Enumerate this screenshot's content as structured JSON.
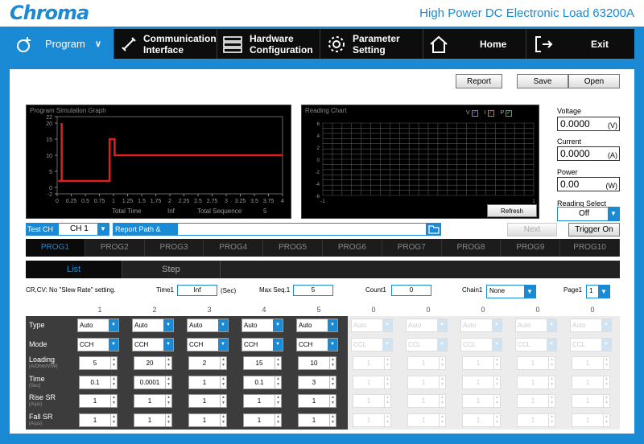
{
  "app": {
    "logo": "Chroma",
    "title": "High Power DC Electronic Load 63200A"
  },
  "nav": {
    "program": "Program",
    "comm1": "Communication",
    "comm2": "Interface",
    "hw1": "Hardware",
    "hw2": "Configuration",
    "ps1": "Parameter",
    "ps2": "Setting",
    "home": "Home",
    "exit": "Exit"
  },
  "toolbar": {
    "report": "Report",
    "save": "Save",
    "open": "Open"
  },
  "sim": {
    "title": "Program Simulation Graph",
    "total_time_label": "Total Time",
    "total_time_val": "Inf",
    "total_seq_label": "Total Sequence",
    "total_seq_val": "5",
    "yticks": [
      "22",
      "20",
      "15",
      "10",
      "5",
      "0",
      "-2"
    ],
    "xticks": [
      "0",
      "0.25",
      "0.5",
      "0.75",
      "1",
      "1.25",
      "1.5",
      "1.75",
      "2",
      "2.25",
      "2.5",
      "2.75",
      "3",
      "3.25",
      "3.5",
      "3.75",
      "4"
    ]
  },
  "reading": {
    "title": "Reading Chart",
    "legend": [
      "V",
      "I",
      "P"
    ],
    "yticks": [
      "6",
      "4",
      "2",
      "0",
      "-2",
      "-4",
      "-6"
    ],
    "xticks": [
      "-1",
      "1"
    ],
    "refresh": "Refresh"
  },
  "meters": {
    "voltage_label": "Voltage",
    "voltage": "0.0000",
    "voltage_unit": "(V)",
    "current_label": "Current",
    "current": "0.0000",
    "current_unit": "(A)",
    "power_label": "Power",
    "power": "0.00",
    "power_unit": "(W)",
    "reading_select_label": "Reading Select",
    "reading_select": "Off"
  },
  "testch": {
    "label": "Test  CH",
    "value": "CH 1",
    "path_label": "Report Path & Name",
    "next": "Next",
    "trigger": "Trigger On"
  },
  "progs": [
    "PROG1",
    "PROG2",
    "PROG3",
    "PROG4",
    "PROG5",
    "PROG6",
    "PROG7",
    "PROG8",
    "PROG9",
    "PROG10"
  ],
  "subtabs": [
    "List",
    "Step"
  ],
  "params": {
    "note": "CR,CV: No \"Slew Rate\" setting.",
    "time_label": "Time1",
    "time_val": "Inf",
    "time_unit": "(Sec)",
    "maxseq_label": "Max Seq.1",
    "maxseq_val": "5",
    "count_label": "Count1",
    "count_val": "0",
    "chain_label": "Chain1",
    "chain_val": "None",
    "page_label": "Page1",
    "page_val": "1"
  },
  "rows": [
    {
      "label": "Type",
      "sub": ""
    },
    {
      "label": "Mode",
      "sub": ""
    },
    {
      "label": "Loading",
      "sub": "(A/Ohm/V/W)"
    },
    {
      "label": "Time",
      "sub": "(Sec)"
    },
    {
      "label": "Rise SR",
      "sub": "(A/µs)"
    },
    {
      "label": "Fall SR",
      "sub": "(A/µs)"
    }
  ],
  "columns": [
    {
      "num": "1",
      "type": "Auto",
      "mode": "CCH",
      "loading": "5",
      "time": "0.1",
      "rise": "1",
      "fall": "1"
    },
    {
      "num": "2",
      "type": "Auto",
      "mode": "CCH",
      "loading": "20",
      "time": "0.0001",
      "rise": "1",
      "fall": "1"
    },
    {
      "num": "3",
      "type": "Auto",
      "mode": "CCH",
      "loading": "2",
      "time": "1",
      "rise": "1",
      "fall": "1"
    },
    {
      "num": "4",
      "type": "Auto",
      "mode": "CCH",
      "loading": "15",
      "time": "0.1",
      "rise": "1",
      "fall": "1"
    },
    {
      "num": "5",
      "type": "Auto",
      "mode": "CCH",
      "loading": "10",
      "time": "3",
      "rise": "1",
      "fall": "1"
    },
    {
      "num": "0",
      "type": "Auto",
      "mode": "CCL",
      "loading": "1",
      "time": "1",
      "rise": "1",
      "fall": "1"
    },
    {
      "num": "0",
      "type": "Auto",
      "mode": "CCL",
      "loading": "1",
      "time": "1",
      "rise": "1",
      "fall": "1"
    },
    {
      "num": "0",
      "type": "Auto",
      "mode": "CCL",
      "loading": "1",
      "time": "1",
      "rise": "1",
      "fall": "1"
    },
    {
      "num": "0",
      "type": "Auto",
      "mode": "CCL",
      "loading": "1",
      "time": "1",
      "rise": "1",
      "fall": "1"
    },
    {
      "num": "0",
      "type": "Auto",
      "mode": "CCL",
      "loading": "1",
      "time": "1",
      "rise": "1",
      "fall": "1"
    }
  ],
  "colors": {
    "accent": "#1a8ad4",
    "trace": "#e02020"
  }
}
